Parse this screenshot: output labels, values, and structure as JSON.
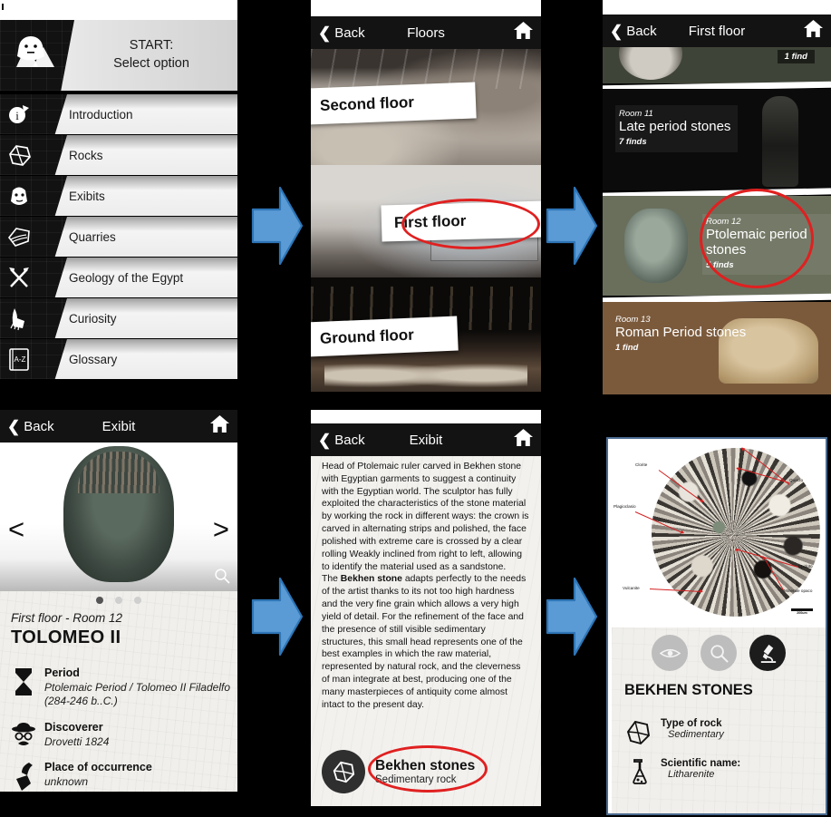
{
  "colors": {
    "accent_red": "#e02020",
    "arrow_blue": "#5b9bd5",
    "arrow_blue_border": "#2e75b6",
    "header_black": "#131313",
    "frame_blue": "#4a6b8f"
  },
  "panel_start": {
    "title_line1": "START:",
    "title_line2": "Select option",
    "menu": [
      {
        "label": "Introduction",
        "icon": "info-icon"
      },
      {
        "label": "Rocks",
        "icon": "rock-icon"
      },
      {
        "label": "Exibits",
        "icon": "pharaoh-head-icon"
      },
      {
        "label": "Quarries",
        "icon": "quarry-icon"
      },
      {
        "label": "Geology of the Egypt",
        "icon": "hammers-icon"
      },
      {
        "label": "Curiosity",
        "icon": "anubis-icon"
      },
      {
        "label": "Glossary",
        "icon": "az-book-icon"
      }
    ]
  },
  "panel_floors": {
    "header": {
      "back": "Back",
      "title": "Floors",
      "home_icon": "home-icon"
    },
    "floors": [
      {
        "label": "Second floor"
      },
      {
        "label": "First floor",
        "highlighted": true
      },
      {
        "label": "Ground floor"
      }
    ]
  },
  "panel_rooms": {
    "header": {
      "back": "Back",
      "title": "First floor",
      "home_icon": "home-icon"
    },
    "partial_top": {
      "finds": "1 find"
    },
    "rooms": [
      {
        "number": "Room 11",
        "name": "Late period stones",
        "finds": "7 finds",
        "highlighted": false
      },
      {
        "number": "Room 12",
        "name": "Ptolemaic period stones",
        "finds": "5 finds",
        "highlighted": true
      },
      {
        "number": "Room 13",
        "name": "Roman Period stones",
        "finds": "1 find",
        "highlighted": false
      }
    ]
  },
  "panel_exhibit": {
    "header": {
      "back": "Back",
      "title": "Exibit",
      "home_icon": "home-icon"
    },
    "prev_icon": "chevron-left-icon",
    "next_icon": "chevron-right-icon",
    "zoom_icon": "magnifier-icon",
    "dots": 3,
    "active_dot": 0,
    "location": "First floor - Room 12",
    "name": "TOLOMEO II",
    "fields": [
      {
        "icon": "hourglass-icon",
        "label": "Period",
        "value": "Ptolemaic Period / Tolomeo II Filadelfo (284-246 b..C.)"
      },
      {
        "icon": "detective-icon",
        "label": "Discoverer",
        "value": "Drovetti 1824"
      },
      {
        "icon": "pickaxe-place-icon",
        "label": "Place of occurrence",
        "value": "unknown"
      }
    ]
  },
  "panel_exhibit_text": {
    "header": {
      "back": "Back",
      "title": "Exibit",
      "home_icon": "home-icon"
    },
    "paragraph1": "Head of Ptolemaic ruler carved in Bekhen stone with Egyptian garments to suggest a continuity with the Egyptian world. The sculptor has fully exploited the characteristics of the stone material by working the rock in different ways: the crown is carved in alternating strips and polished, the face polished with extreme care is crossed by a clear rolling Weakly inclined from right to left, allowing to identify the material used as a sandstone.",
    "paragraph2_pre": "The ",
    "paragraph2_bold": "Bekhen stone",
    "paragraph2_post": " adapts perfectly to the needs of the artist thanks to its not too high hardness and the very fine grain which allows a very high yield of detail. For the refinement of the face and the presence of still visible sedimentary structures, this small head represents one of the best examples in which the raw material, represented by natural rock, and the cleverness of man integrate at best, producing one of the many masterpieces of antiquity come almost intact to the present day.",
    "rock_chip": {
      "icon": "rock-icon",
      "name": "Bekhen stones",
      "subtitle": "Sedimentary rock",
      "highlighted": true
    }
  },
  "panel_rock_detail": {
    "microscope_image": {
      "labels": [
        {
          "text": "Clorite"
        },
        {
          "text": "Quarzo"
        },
        {
          "text": "Plagioclasio"
        },
        {
          "text": "Epidoto"
        },
        {
          "text": "Vulcanite"
        },
        {
          "text": "Minerale opaco"
        }
      ],
      "scale_label": "200um"
    },
    "view_modes": [
      {
        "icon": "eye-icon",
        "active": false
      },
      {
        "icon": "magnifier-icon",
        "active": false
      },
      {
        "icon": "microscope-icon",
        "active": true
      }
    ],
    "title": "BEKHEN STONES",
    "fields": [
      {
        "icon": "rock-icon",
        "label": "Type of rock",
        "value": "Sedimentary"
      },
      {
        "icon": "flask-icon",
        "label": "Scientific name:",
        "value": "Litharenite"
      }
    ]
  },
  "flow_arrows": [
    {
      "name": "arrow-start-to-floors"
    },
    {
      "name": "arrow-floors-to-rooms"
    },
    {
      "name": "arrow-exhibit-to-text"
    },
    {
      "name": "arrow-text-to-rock"
    }
  ]
}
